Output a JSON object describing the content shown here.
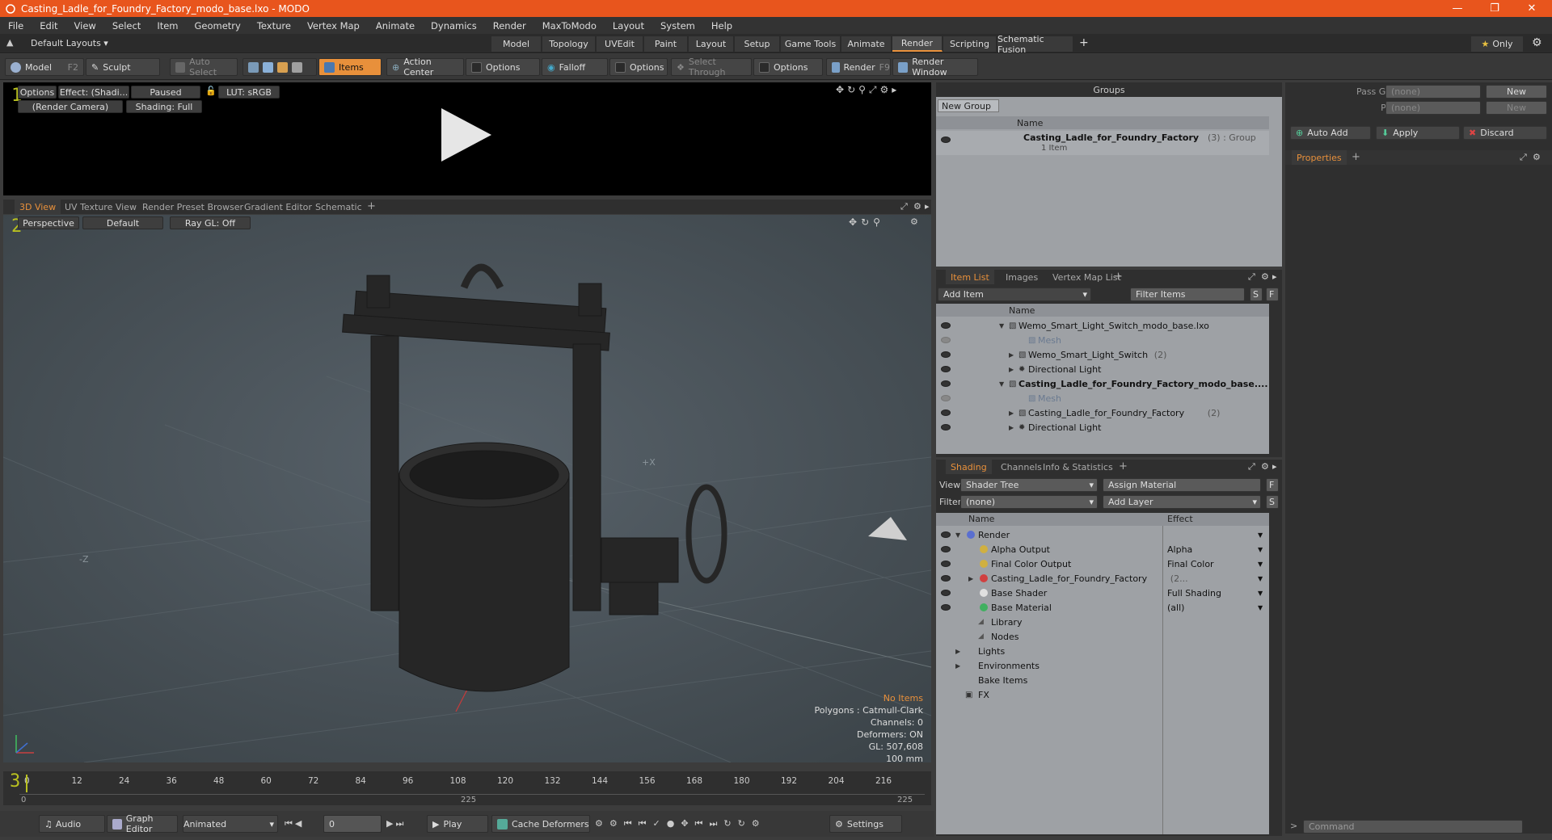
{
  "window": {
    "title": "Casting_Ladle_for_Foundry_Factory_modo_base.lxo - MODO"
  },
  "menu": [
    "File",
    "Edit",
    "View",
    "Select",
    "Item",
    "Geometry",
    "Texture",
    "Vertex Map",
    "Animate",
    "Dynamics",
    "Render",
    "MaxToModo",
    "Layout",
    "System",
    "Help"
  ],
  "layouts": {
    "default_label": "Default Layouts ▾",
    "tabs": [
      "Model",
      "Topology",
      "UVEdit",
      "Paint",
      "Layout",
      "Setup",
      "Game Tools",
      "Animate",
      "Render",
      "Scripting",
      "Schematic Fusion"
    ],
    "active": "Render",
    "only_label": "Only"
  },
  "toolbar": {
    "model": "Model",
    "model_key": "F2",
    "sculpt": "Sculpt",
    "auto_select": "Auto Select",
    "items": "Items",
    "action_center": "Action Center",
    "options1": "Options",
    "falloff": "Falloff",
    "options2": "Options",
    "select_through": "Select Through",
    "options3": "Options",
    "render": "Render",
    "render_key": "F9",
    "render_window": "Render Window"
  },
  "render_view": {
    "options": "Options",
    "effect": "Effect: (Shadi...",
    "paused": "Paused",
    "lut": "LUT: sRGB",
    "camera": "(Render Camera)",
    "shading": "Shading: Full"
  },
  "view_tabs": [
    "3D View",
    "UV Texture View",
    "Render Preset Browser",
    "Gradient Editor",
    "Schematic"
  ],
  "viewport": {
    "perspective": "Perspective",
    "default": "Default",
    "raygl": "Ray GL: Off",
    "axis_x": "+X",
    "axis_z": "-Z",
    "stats": {
      "no_items": "No Items",
      "polygons": "Polygons : Catmull-Clark",
      "channels": "Channels: 0",
      "deformers": "Deformers: ON",
      "gl": "GL: 507,608",
      "scale": "100 mm"
    }
  },
  "timeline": {
    "ticks": [
      "0",
      "12",
      "24",
      "36",
      "48",
      "60",
      "72",
      "84",
      "96",
      "108",
      "120",
      "132",
      "144",
      "156",
      "168",
      "180",
      "192",
      "204",
      "216"
    ],
    "sub_start": "0",
    "sub_mid": "225",
    "sub_end": "225"
  },
  "bottom": {
    "audio": "Audio",
    "graph_editor": "Graph Editor",
    "animated": "Animated",
    "frame": "0",
    "play": "Play",
    "cache": "Cache Deformers",
    "settings": "Settings",
    "command": "Command"
  },
  "groups": {
    "title": "Groups",
    "new_group": "New Group",
    "name_col": "Name",
    "item_name": "Casting_Ladle_for_Foundry_Factory",
    "item_meta": "(3) : Group",
    "item_sub": "1 Item"
  },
  "pass": {
    "pass_groups": "Pass Groups",
    "passes": "Passes",
    "none": "(none)",
    "new": "New",
    "auto_add": "Auto Add",
    "apply": "Apply",
    "discard": "Discard",
    "properties": "Properties"
  },
  "itemlist": {
    "tabs": [
      "Item List",
      "Images",
      "Vertex Map List"
    ],
    "add_item": "Add Item",
    "filter": "Filter Items",
    "name_col": "Name",
    "rows": [
      {
        "label": "Wemo_Smart_Light_Switch_modo_base.lxo",
        "indent": 0,
        "bold": false,
        "dim": false
      },
      {
        "label": "Mesh",
        "indent": 2,
        "bold": false,
        "dim": true
      },
      {
        "label": "Wemo_Smart_Light_Switch",
        "extra": "(2)",
        "indent": 1,
        "bold": false,
        "dim": false
      },
      {
        "label": "Directional Light",
        "indent": 1,
        "bold": false,
        "dim": false
      },
      {
        "label": "Casting_Ladle_for_Foundry_Factory_modo_base....",
        "indent": 0,
        "bold": true,
        "dim": false
      },
      {
        "label": "Mesh",
        "indent": 2,
        "bold": false,
        "dim": true
      },
      {
        "label": "Casting_Ladle_for_Foundry_Factory",
        "extra": "(2)",
        "indent": 1,
        "bold": false,
        "dim": false
      },
      {
        "label": "Directional Light",
        "indent": 1,
        "bold": false,
        "dim": false
      }
    ]
  },
  "shading": {
    "tabs": [
      "Shading",
      "Channels",
      "Info & Statistics"
    ],
    "view_label": "View",
    "view_value": "Shader Tree",
    "assign": "Assign Material",
    "filter_label": "Filter",
    "filter_value": "(none)",
    "add_layer": "Add Layer",
    "name_col": "Name",
    "effect_col": "Effect",
    "rows": [
      {
        "label": "Render",
        "effect": "",
        "indent": 0,
        "color": "#5a6fd0"
      },
      {
        "label": "Alpha Output",
        "effect": "Alpha",
        "indent": 1,
        "color": "#d0b040"
      },
      {
        "label": "Final Color Output",
        "effect": "Final Color",
        "indent": 1,
        "color": "#d0b040"
      },
      {
        "label": "Casting_Ladle_for_Foundry_Factory",
        "extra": "(2...",
        "effect": "",
        "indent": 1,
        "color": "#d04040"
      },
      {
        "label": "Base Shader",
        "effect": "Full Shading",
        "indent": 1,
        "color": "#e0e0e0"
      },
      {
        "label": "Base Material",
        "effect": "(all)",
        "indent": 1,
        "color": "#40b060"
      },
      {
        "label": "Library",
        "effect": "",
        "indent": 1,
        "color": ""
      },
      {
        "label": "Nodes",
        "effect": "",
        "indent": 1,
        "color": ""
      },
      {
        "label": "Lights",
        "effect": "",
        "indent": 0,
        "color": ""
      },
      {
        "label": "Environments",
        "effect": "",
        "indent": 0,
        "color": ""
      },
      {
        "label": "Bake Items",
        "effect": "",
        "indent": 0,
        "color": ""
      },
      {
        "label": "FX",
        "effect": "",
        "indent": 0,
        "color": ""
      }
    ]
  }
}
